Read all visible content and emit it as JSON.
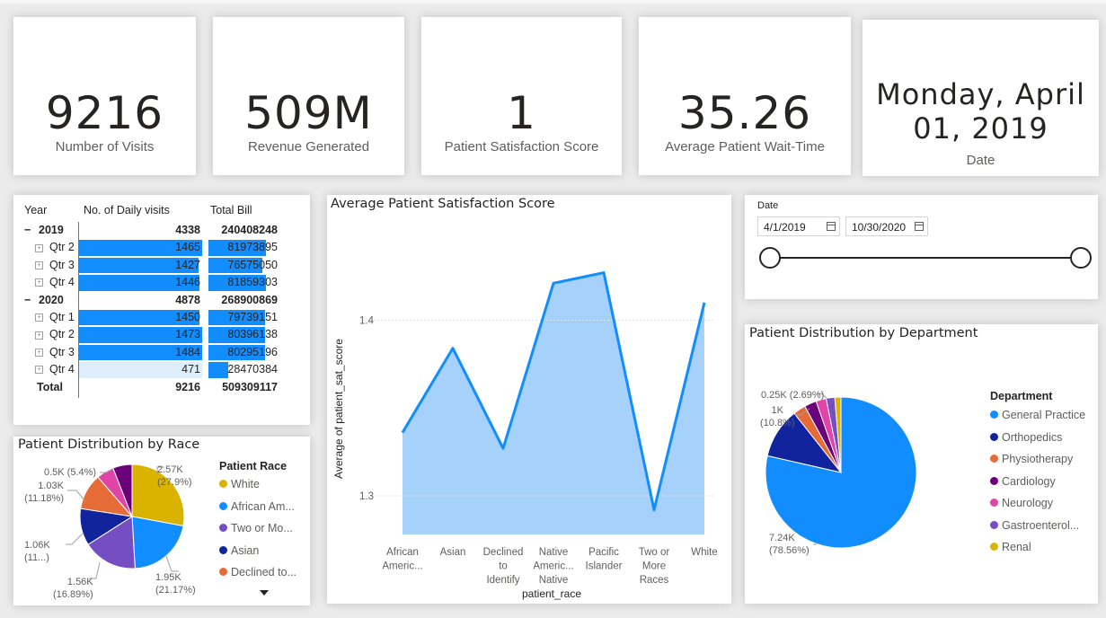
{
  "kpis": [
    {
      "value": "9216",
      "label": "Number of Visits"
    },
    {
      "value": "509M",
      "label": "Revenue Generated"
    },
    {
      "value": "1",
      "label": "Patient Satisfaction Score"
    },
    {
      "value": "35.26",
      "label": "Average Patient Wait-Time"
    }
  ],
  "date_card": {
    "line1": "Monday, April",
    "line2": "01, 2019",
    "label": "Date"
  },
  "matrix": {
    "headers": {
      "year": "Year",
      "visits": "No. of Daily visits",
      "bill": "Total Bill"
    },
    "rows": [
      {
        "label": "2019",
        "visits": "4338",
        "bill": "240408248",
        "level": "year"
      },
      {
        "label": "Qtr 2",
        "visits": "1465",
        "bill": "81973895",
        "level": "qtr",
        "visits_frac": 1.0,
        "bill_frac": 0.97
      },
      {
        "label": "Qtr 3",
        "visits": "1427",
        "bill": "76575050",
        "level": "qtr",
        "visits_frac": 0.97,
        "bill_frac": 0.91
      },
      {
        "label": "Qtr 4",
        "visits": "1446",
        "bill": "81859303",
        "level": "qtr",
        "visits_frac": 0.98,
        "bill_frac": 0.97
      },
      {
        "label": "2020",
        "visits": "4878",
        "bill": "268900869",
        "level": "year"
      },
      {
        "label": "Qtr 1",
        "visits": "1450",
        "bill": "79739151",
        "level": "qtr",
        "visits_frac": 0.98,
        "bill_frac": 0.95
      },
      {
        "label": "Qtr 2",
        "visits": "1473",
        "bill": "80396138",
        "level": "qtr",
        "visits_frac": 1.0,
        "bill_frac": 0.95
      },
      {
        "label": "Qtr 3",
        "visits": "1484",
        "bill": "80295196",
        "level": "qtr",
        "visits_frac": 1.0,
        "bill_frac": 0.95
      },
      {
        "label": "Qtr 4",
        "visits": "471",
        "bill": "28470384",
        "level": "qtr",
        "visits_frac": 0.32,
        "bill_frac": 0.34
      }
    ],
    "total": {
      "label": "Total",
      "visits": "9216",
      "bill": "509309117"
    },
    "colors": {
      "bar": "#118dff",
      "light_bar": "#deeefc"
    }
  },
  "race_pie": {
    "title": "Patient Distribution by Race",
    "legend_title": "Patient Race",
    "legend": [
      {
        "name": "White",
        "color": "#d9b300"
      },
      {
        "name": "African Am...",
        "color": "#118dff"
      },
      {
        "name": "Two or Mo...",
        "color": "#744ec2"
      },
      {
        "name": "Asian",
        "color": "#12239e"
      },
      {
        "name": "Declined to...",
        "color": "#e66c37"
      }
    ],
    "labels": [
      {
        "line1": "2.57K",
        "line2": "(27.9%)"
      },
      {
        "line1": "1.95K",
        "line2": "(21.17%)"
      },
      {
        "line1": "1.56K",
        "line2": "(16.89%)"
      },
      {
        "line1": "1.06K",
        "line2": "(11...)"
      },
      {
        "line1": "1.03K",
        "line2": "(11.18%)"
      },
      {
        "line1": "0.5K (5.4%)",
        "line2": ""
      }
    ],
    "more_icon": "triangle-down-icon"
  },
  "line_chart": {
    "title": "Average Patient Satisfaction Score",
    "ylabel": "Average of patient_sat_score",
    "xlabel": "patient_race",
    "yticks": [
      "1.4",
      "1.3"
    ],
    "categories": [
      [
        "African",
        "Americ..."
      ],
      [
        "Asian"
      ],
      [
        "Declined",
        "to",
        "Identify"
      ],
      [
        "Native",
        "Americ...",
        "Native"
      ],
      [
        "Pacific",
        "Islander"
      ],
      [
        "Two or",
        "More",
        "Races"
      ],
      [
        "White"
      ]
    ]
  },
  "slicer": {
    "title": "Date",
    "start": "4/1/2019",
    "end": "10/30/2020"
  },
  "dept_pie": {
    "title": "Patient Distribution by Department",
    "legend_title": "Department",
    "legend": [
      {
        "name": "General Practice",
        "color": "#118dff"
      },
      {
        "name": "Orthopedics",
        "color": "#12239e"
      },
      {
        "name": "Physiotherapy",
        "color": "#e66c37"
      },
      {
        "name": "Cardiology",
        "color": "#6b007b"
      },
      {
        "name": "Neurology",
        "color": "#e044a7"
      },
      {
        "name": "Gastroenterol...",
        "color": "#744ec2"
      },
      {
        "name": "Renal",
        "color": "#d9b300"
      }
    ],
    "labels": [
      {
        "line1": "0.25K (2.69%)",
        "line2": ""
      },
      {
        "line1": "1K",
        "line2": "(10.8%)"
      },
      {
        "line1": "7.24K",
        "line2": "(78.56%)"
      }
    ]
  },
  "chart_data": [
    {
      "type": "line",
      "title": "Average Patient Satisfaction Score",
      "xlabel": "patient_race",
      "ylabel": "Average of patient_sat_score",
      "categories": [
        "African Americ...",
        "Asian",
        "Declined to Identify",
        "Native Americ... Native",
        "Pacific Islander",
        "Two or More Races",
        "White"
      ],
      "values": [
        1.336,
        1.384,
        1.327,
        1.421,
        1.427,
        1.292,
        1.41
      ],
      "ylim": [
        1.278,
        1.46
      ],
      "area": true,
      "color": "#118dff",
      "fill": "#a6d1fb"
    },
    {
      "type": "pie",
      "title": "Patient Distribution by Race",
      "slices": [
        {
          "name": "White",
          "value": 27.9,
          "color": "#d9b300"
        },
        {
          "name": "African Am...",
          "value": 21.17,
          "color": "#118dff"
        },
        {
          "name": "Two or Mo...",
          "value": 16.89,
          "color": "#744ec2"
        },
        {
          "name": "Asian",
          "value": 11.5,
          "color": "#12239e"
        },
        {
          "name": "Declined to...",
          "value": 11.18,
          "color": "#e66c37"
        },
        {
          "name": "",
          "value": 5.4,
          "color": "#e044a7"
        },
        {
          "name": "",
          "value": 5.96,
          "color": "#6b007b"
        }
      ]
    },
    {
      "type": "pie",
      "title": "Patient Distribution by Department",
      "slices": [
        {
          "name": "General Practice",
          "value": 78.56,
          "color": "#118dff"
        },
        {
          "name": "Orthopedics",
          "value": 10.8,
          "color": "#12239e"
        },
        {
          "name": "Physiotherapy",
          "value": 2.69,
          "color": "#e66c37"
        },
        {
          "name": "Cardiology",
          "value": 2.6,
          "color": "#6b007b"
        },
        {
          "name": "Neurology",
          "value": 2.2,
          "color": "#e044a7"
        },
        {
          "name": "Gastroenterol...",
          "value": 1.85,
          "color": "#744ec2"
        },
        {
          "name": "Renal",
          "value": 1.3,
          "color": "#d9b300"
        }
      ]
    }
  ]
}
